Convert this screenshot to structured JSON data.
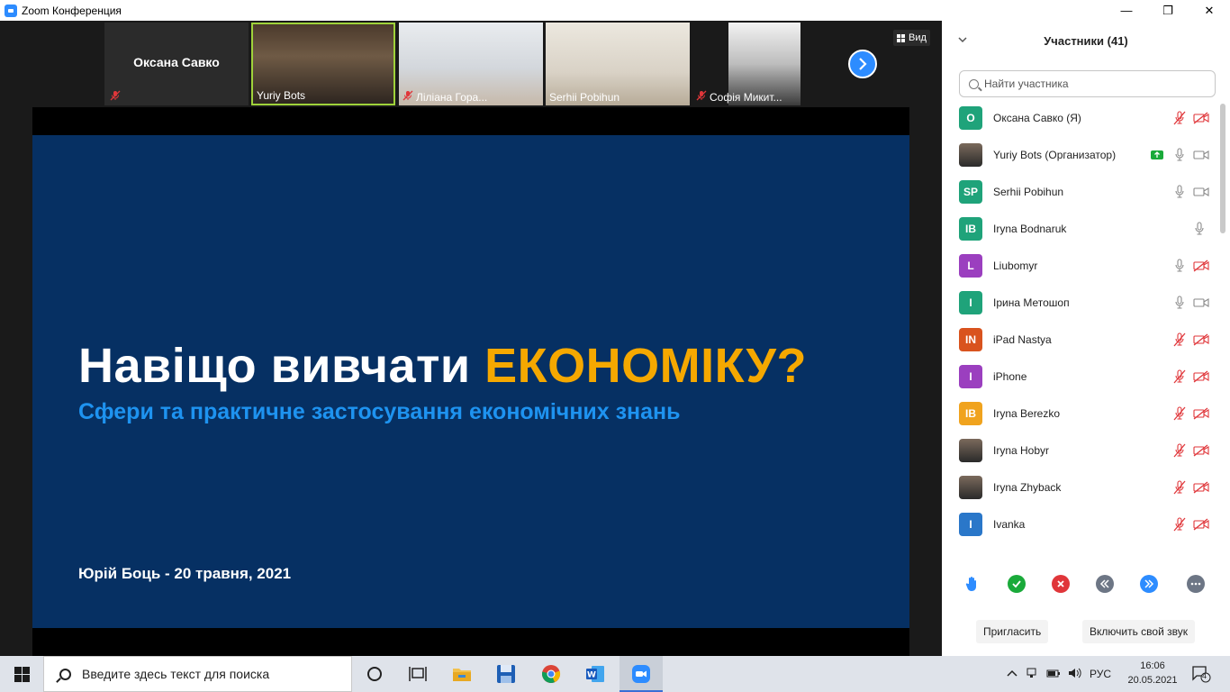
{
  "window": {
    "title": "Zoom Конференция",
    "controls": {
      "minimize": "—",
      "maximize": "❐",
      "close": "✕"
    }
  },
  "gallery": {
    "tiles": [
      {
        "name": "Оксана Савко",
        "muted": true,
        "has_video": false
      },
      {
        "name": "Yuriy Bots",
        "muted": false,
        "has_video": true,
        "active_speaker": true
      },
      {
        "name": "Ліліана Гора...",
        "muted": true,
        "has_video": true
      },
      {
        "name": "Serhii Pobihun",
        "muted": false,
        "has_video": true
      },
      {
        "name": "Софія Микит...",
        "muted": true,
        "has_video": true
      }
    ],
    "view_button": "Вид"
  },
  "slide": {
    "title_white": "Навіщо вивчати ",
    "title_highlight": "ЕКОНОМІКУ?",
    "subtitle": "Сфери та практичне застосування економічних знань",
    "author_line": "Юрій Боць - 20 травня, 2021",
    "colors": {
      "background": "#063063",
      "highlight": "#f5a800",
      "subtitle": "#1e93f0"
    }
  },
  "participants_panel": {
    "title": "Участники (41)",
    "search_placeholder": "Найти участника",
    "participants": [
      {
        "initials": "О",
        "name": "Оксана Савко (Я)",
        "avatar_color": "#1fa37a",
        "mic": "off",
        "cam": "off"
      },
      {
        "initials": "",
        "name": "Yuriy Bots (Организатор)",
        "avatar_color": "photo",
        "mic": "on",
        "cam": "on",
        "sharing": true
      },
      {
        "initials": "SP",
        "name": "Serhii Pobihun",
        "avatar_color": "#1fa37a",
        "mic": "on",
        "cam": "on"
      },
      {
        "initials": "IB",
        "name": "Iryna Bodnaruk",
        "avatar_color": "#1fa37a",
        "mic": "on",
        "cam": "none"
      },
      {
        "initials": "L",
        "name": "Liubomyr",
        "avatar_color": "#9b3fbf",
        "mic": "on",
        "cam": "off"
      },
      {
        "initials": "І",
        "name": "Ірина Метошоп",
        "avatar_color": "#1fa37a",
        "mic": "on",
        "cam": "on"
      },
      {
        "initials": "IN",
        "name": "iPad Nastya",
        "avatar_color": "#d9531e",
        "mic": "off",
        "cam": "off"
      },
      {
        "initials": "I",
        "name": "iPhone",
        "avatar_color": "#9b3fbf",
        "mic": "off",
        "cam": "off"
      },
      {
        "initials": "IB",
        "name": "Iryna Berezko",
        "avatar_color": "#f0a31e",
        "mic": "off",
        "cam": "off"
      },
      {
        "initials": "",
        "name": "Iryna Hobyr",
        "avatar_color": "photo",
        "mic": "off",
        "cam": "off"
      },
      {
        "initials": "",
        "name": "Iryna Zhyback",
        "avatar_color": "photo",
        "mic": "off",
        "cam": "off"
      },
      {
        "initials": "I",
        "name": "Ivanka",
        "avatar_color": "#2a77c9",
        "mic": "off",
        "cam": "off"
      }
    ],
    "reactions": [
      {
        "name": "raise-hand-icon",
        "color": "#2d8cff"
      },
      {
        "name": "yes-icon",
        "color": "#1aaa3a"
      },
      {
        "name": "no-icon",
        "color": "#e0363a"
      },
      {
        "name": "slower-icon",
        "color": "#6d7685"
      },
      {
        "name": "faster-icon",
        "color": "#2d8cff"
      },
      {
        "name": "more-icon",
        "color": "#6d7685"
      }
    ],
    "invite_button": "Пригласить",
    "unmute_button": "Включить свой звук"
  },
  "taskbar": {
    "search_text": "Введите здесь текст для поиска",
    "language": "РУС",
    "time": "16:06",
    "date": "20.05.2021",
    "notification_count": "4"
  }
}
